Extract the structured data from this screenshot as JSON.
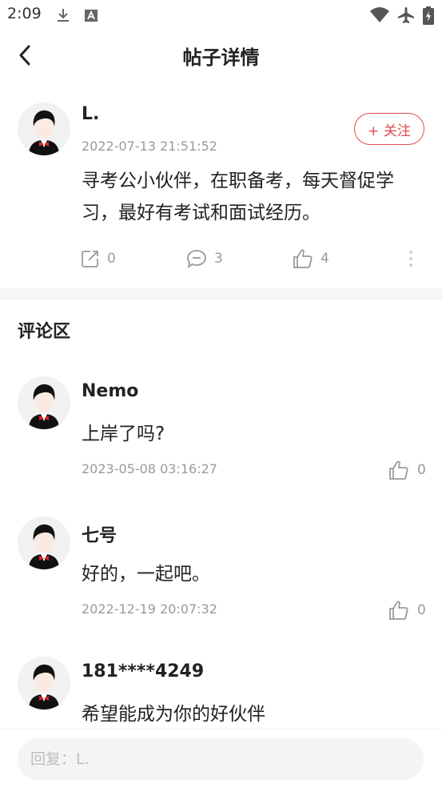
{
  "status_bar": {
    "time": "2:09"
  },
  "header": {
    "title": "帖子详情"
  },
  "post": {
    "username": "L.",
    "time": "2022-07-13 21:51:52",
    "follow_label": "+ 关注",
    "content": "寻考公小伙伴，在职备考，每天督促学习，最好有考试和面试经历。",
    "shares": "0",
    "comments": "3",
    "likes": "4"
  },
  "comments_section": {
    "title": "评论区",
    "items": [
      {
        "username": "Nemo",
        "text": "上岸了吗?",
        "time": "2023-05-08 03:16:27",
        "likes": "0"
      },
      {
        "username": "七号",
        "text": "好的，一起吧。",
        "time": "2022-12-19 20:07:32",
        "likes": "0"
      },
      {
        "username": "181****4249",
        "text": "希望能成为你的好伙伴"
      }
    ]
  },
  "reply": {
    "placeholder": "回复：L."
  },
  "colors": {
    "accent": "#e04a4a",
    "muted": "#9a9a9a",
    "avatar_bg": "#f1f1f1"
  },
  "icons": [
    "download-icon",
    "app-notification-icon",
    "wifi-icon",
    "airplane-mode-icon",
    "battery-icon",
    "back-arrow-icon",
    "share-edit-icon",
    "comment-icon",
    "thumbs-up-icon",
    "more-vertical-icon"
  ]
}
